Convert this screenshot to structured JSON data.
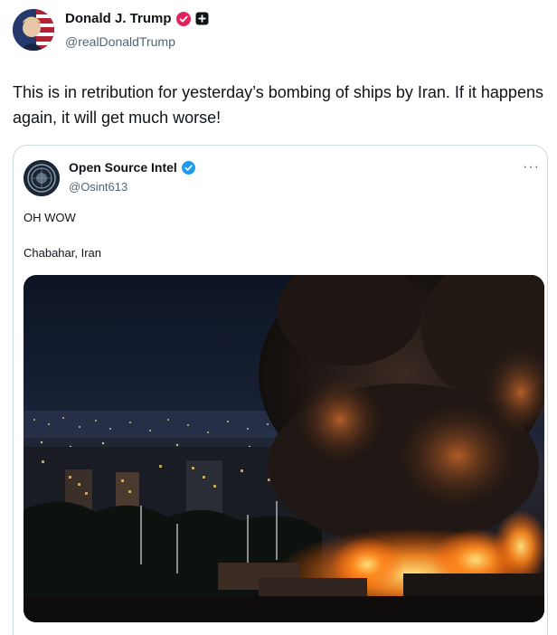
{
  "post": {
    "author_name": "Donald J. Trump",
    "author_handle": "@realDonaldTrump",
    "text": "This is in retribution for yesterday’s bombing of ships by Iran. If it happens again, it will get much worse!"
  },
  "quoted": {
    "author_name": "Open Source Intel",
    "author_handle": "@Osint613",
    "more": "···",
    "line1": "OH WOW",
    "line2": "Chabahar, Iran"
  },
  "colors": {
    "verified_pink": "#e0245e",
    "verified_blue": "#1d9bf0",
    "text_primary": "#0f1419",
    "text_secondary": "#536471",
    "border": "#cfd9de"
  },
  "icons": {
    "verified_badge": "verified-badge-icon",
    "affiliate_badge": "affiliate-badge-icon",
    "more": "more-icon"
  }
}
